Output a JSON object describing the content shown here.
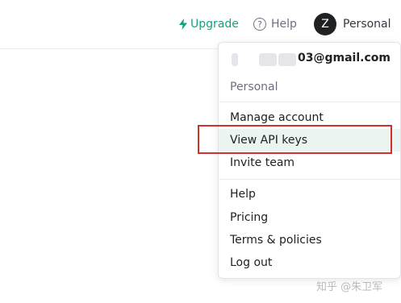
{
  "header": {
    "upgrade_label": "Upgrade",
    "help_label": "Help",
    "avatar_initial": "Z",
    "profile_label": "Personal"
  },
  "menu": {
    "email_visible": "03@gmail.com",
    "organization": "Personal",
    "group1": [
      "Manage account",
      "View API keys",
      "Invite team"
    ],
    "group2": [
      "Help",
      "Pricing",
      "Terms & policies",
      "Log out"
    ]
  },
  "watermark": "知乎 @朱卫军",
  "colors": {
    "accent": "#10a37f",
    "highlight_row": "#ecf4f2",
    "annotation_box": "#d0312d"
  }
}
